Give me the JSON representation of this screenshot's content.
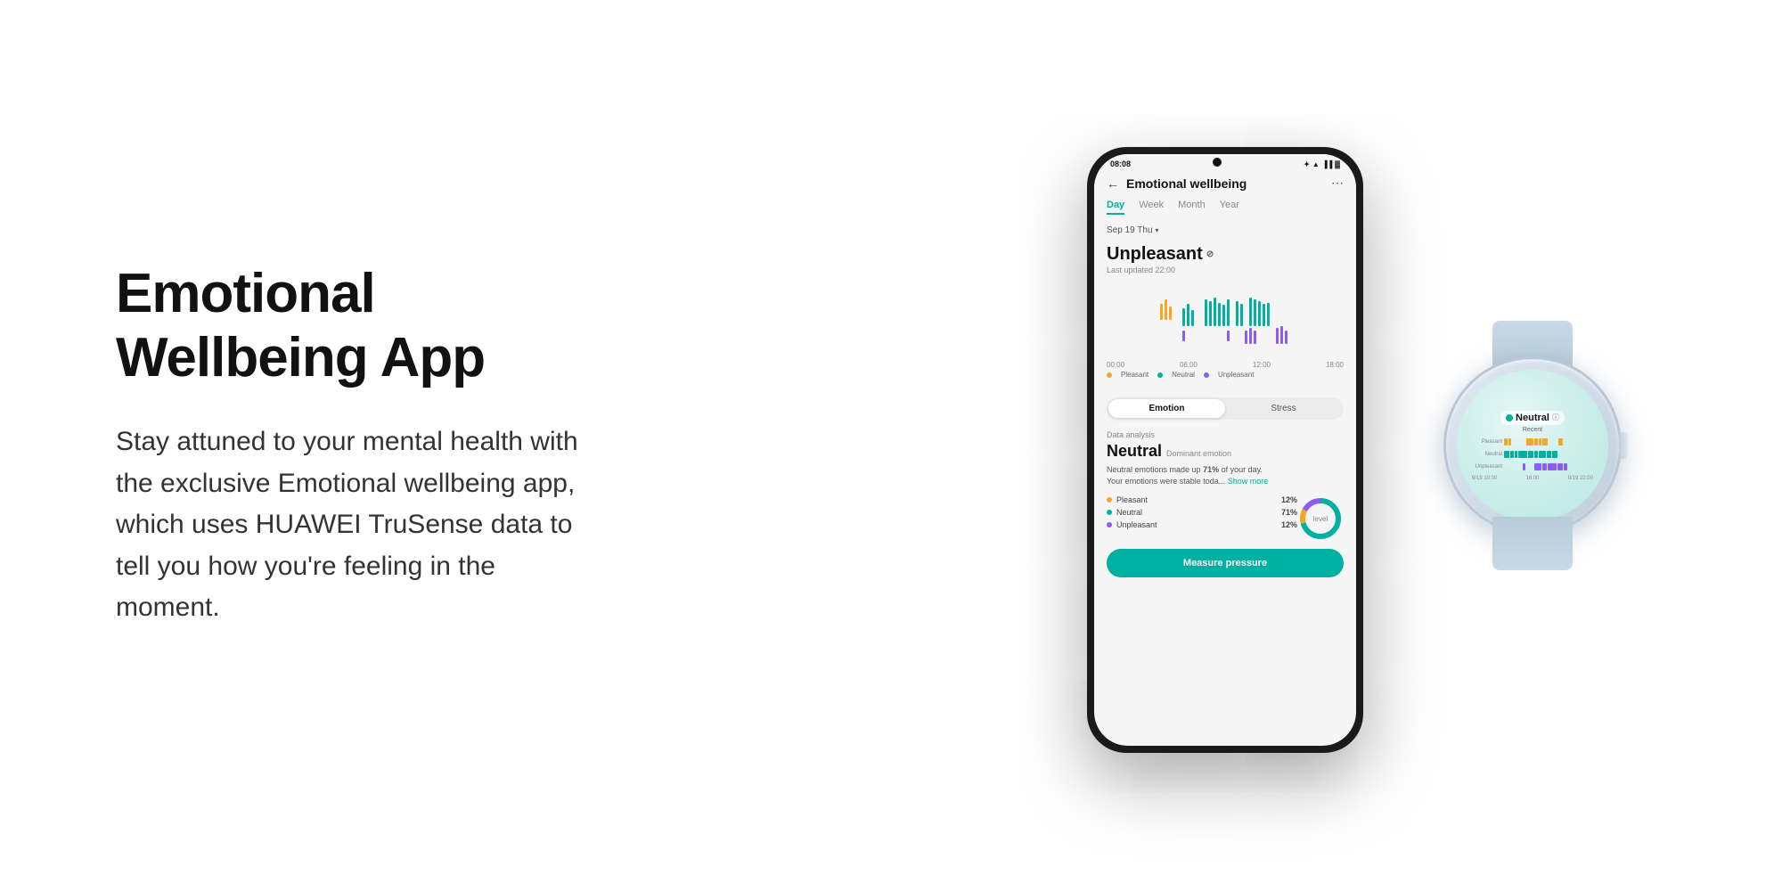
{
  "page": {
    "background": "#ffffff"
  },
  "left": {
    "title": "Emotional Wellbeing App",
    "description": "Stay attuned to your mental health with the exclusive Emotional wellbeing app, which uses HUAWEI TruSense data to tell you how you're feeling in the moment."
  },
  "phone": {
    "status_bar": {
      "time": "08:08",
      "icons": "🔵 📶 📶 🔋"
    },
    "header": {
      "back_label": "←",
      "title": "Emotional wellbeing",
      "menu_icon": "⋯"
    },
    "tabs": [
      {
        "label": "Day",
        "active": true
      },
      {
        "label": "Week",
        "active": false
      },
      {
        "label": "Month",
        "active": false
      },
      {
        "label": "Year",
        "active": false
      }
    ],
    "date": "Sep 19 Thu",
    "emotion": {
      "current": "Unpleasant",
      "last_updated": "Last updated 22:00"
    },
    "chart": {
      "axis": [
        "00:00",
        "06:00",
        "12:00",
        "18:00"
      ],
      "legend": [
        {
          "label": "Pleasant",
          "color": "#f5a623"
        },
        {
          "label": "Neutral",
          "color": "#00b0a0"
        },
        {
          "label": "Unpleasant",
          "color": "#8b5cf6"
        }
      ]
    },
    "toggle": {
      "option1": "Emotion",
      "option2": "Stress",
      "active": "Emotion"
    },
    "analysis": {
      "section_label": "Data analysis",
      "dominant": "Neutral",
      "dominant_sub": "Dominant emotion",
      "description": "Neutral emotions made up 71% of your day.\nYour emotions were stable toda...",
      "show_more": "Show more",
      "stats": [
        {
          "label": "Pleasant",
          "value": "12%",
          "color": "#f5a623"
        },
        {
          "label": "Neutral",
          "value": "71%",
          "color": "#00b0a0"
        },
        {
          "label": "Unpleasant",
          "value": "12%",
          "color": "#8b5cf6"
        }
      ],
      "donut_label": "level"
    },
    "measure_button": "Measure pressure"
  },
  "watch": {
    "status": "Neutral",
    "info_icon": "ⓘ",
    "recent_label": "Recent",
    "row_labels": [
      "Pleasant",
      "Neutral",
      "Unpleasant"
    ],
    "time_labels": [
      "9/19 10:00",
      "16:00",
      "9/19 22:00"
    ],
    "bar_colors": {
      "pleasant": "#f5a623",
      "neutral": "#00b0a0",
      "unpleasant": "#8b5cf6"
    }
  }
}
